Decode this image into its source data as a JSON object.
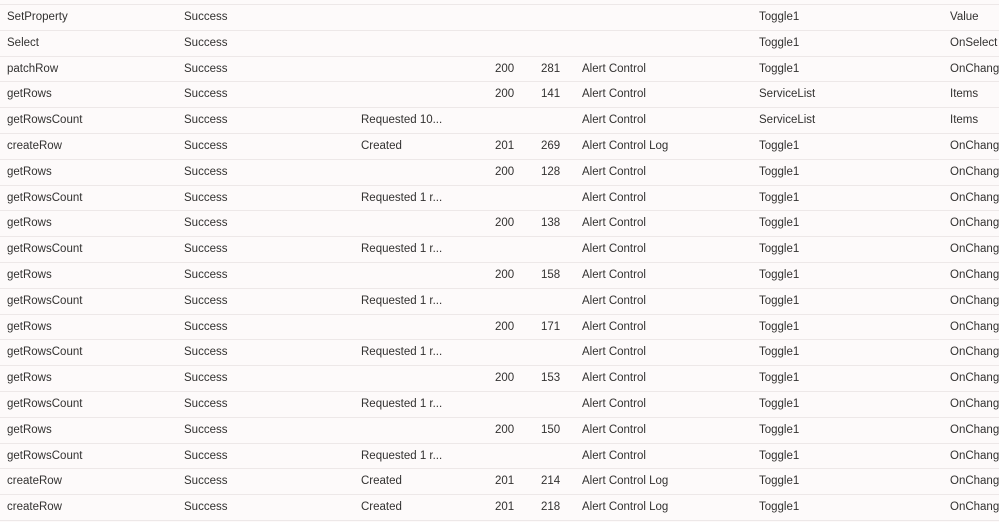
{
  "rows": [
    [
      "SetProperty",
      "Success",
      "",
      "",
      "",
      "",
      "Toggle1",
      "Value"
    ],
    [
      "Select",
      "Success",
      "",
      "",
      "",
      "",
      "Toggle1",
      "OnSelect"
    ],
    [
      "patchRow",
      "Success",
      "",
      "200",
      "281",
      "Alert Control",
      "Toggle1",
      "OnChange"
    ],
    [
      "getRows",
      "Success",
      "",
      "200",
      "141",
      "Alert Control",
      "ServiceList",
      "Items"
    ],
    [
      "getRowsCount",
      "Success",
      "Requested 10...",
      "",
      "",
      "Alert Control",
      "ServiceList",
      "Items"
    ],
    [
      "createRow",
      "Success",
      "Created",
      "201",
      "269",
      "Alert Control Log",
      "Toggle1",
      "OnChange"
    ],
    [
      "getRows",
      "Success",
      "",
      "200",
      "128",
      "Alert Control",
      "Toggle1",
      "OnChange"
    ],
    [
      "getRowsCount",
      "Success",
      "Requested 1 r...",
      "",
      "",
      "Alert Control",
      "Toggle1",
      "OnChange"
    ],
    [
      "getRows",
      "Success",
      "",
      "200",
      "138",
      "Alert Control",
      "Toggle1",
      "OnChange"
    ],
    [
      "getRowsCount",
      "Success",
      "Requested 1 r...",
      "",
      "",
      "Alert Control",
      "Toggle1",
      "OnChange"
    ],
    [
      "getRows",
      "Success",
      "",
      "200",
      "158",
      "Alert Control",
      "Toggle1",
      "OnChange"
    ],
    [
      "getRowsCount",
      "Success",
      "Requested 1 r...",
      "",
      "",
      "Alert Control",
      "Toggle1",
      "OnChange"
    ],
    [
      "getRows",
      "Success",
      "",
      "200",
      "171",
      "Alert Control",
      "Toggle1",
      "OnChange"
    ],
    [
      "getRowsCount",
      "Success",
      "Requested 1 r...",
      "",
      "",
      "Alert Control",
      "Toggle1",
      "OnChange"
    ],
    [
      "getRows",
      "Success",
      "",
      "200",
      "153",
      "Alert Control",
      "Toggle1",
      "OnChange"
    ],
    [
      "getRowsCount",
      "Success",
      "Requested 1 r...",
      "",
      "",
      "Alert Control",
      "Toggle1",
      "OnChange"
    ],
    [
      "getRows",
      "Success",
      "",
      "200",
      "150",
      "Alert Control",
      "Toggle1",
      "OnChange"
    ],
    [
      "getRowsCount",
      "Success",
      "Requested 1 r...",
      "",
      "",
      "Alert Control",
      "Toggle1",
      "OnChange"
    ],
    [
      "createRow",
      "Success",
      "Created",
      "201",
      "214",
      "Alert Control Log",
      "Toggle1",
      "OnChange"
    ],
    [
      "createRow",
      "Success",
      "Created",
      "201",
      "218",
      "Alert Control Log",
      "Toggle1",
      "OnChange"
    ]
  ]
}
